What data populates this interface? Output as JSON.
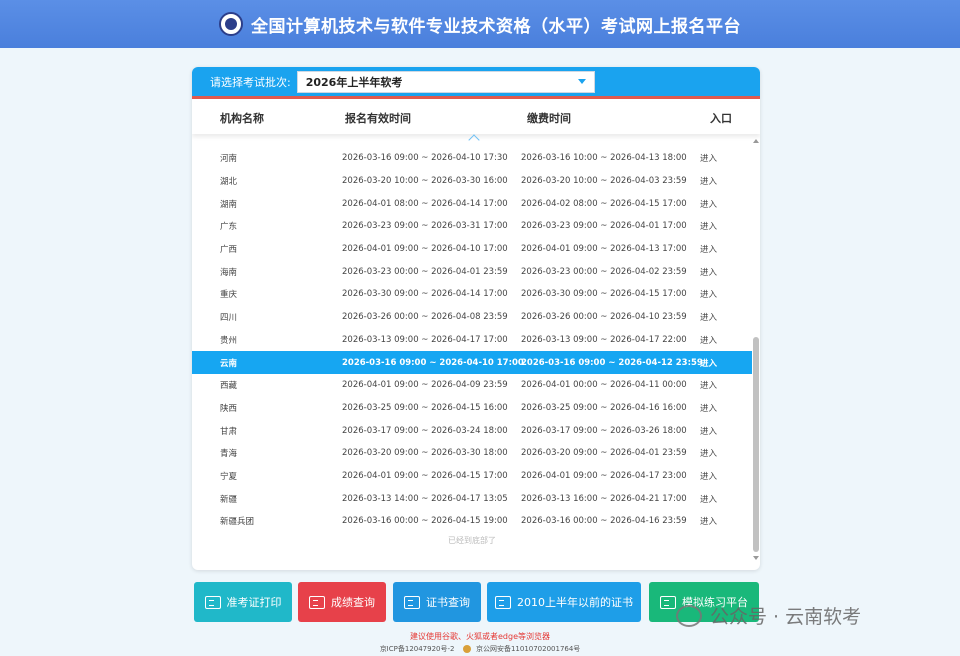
{
  "header": {
    "title": "全国计算机技术与软件专业技术资格（水平）考试网上报名平台"
  },
  "batch": {
    "label": "请选择考试批次:",
    "selected": "2026年上半年软考"
  },
  "table": {
    "columns": [
      "机构名称",
      "报名有效时间",
      "缴费时间",
      "入口"
    ],
    "rows": [
      {
        "name": "河南",
        "reg": "2026-03-16 09:00 ~ 2026-04-10 17:30",
        "pay": "2026-03-16 10:00 ~ 2026-04-13 18:00",
        "entry": "进入"
      },
      {
        "name": "湖北",
        "reg": "2026-03-20 10:00 ~ 2026-03-30 16:00",
        "pay": "2026-03-20 10:00 ~ 2026-04-03 23:59",
        "entry": "进入"
      },
      {
        "name": "湖南",
        "reg": "2026-04-01 08:00 ~ 2026-04-14 17:00",
        "pay": "2026-04-02 08:00 ~ 2026-04-15 17:00",
        "entry": "进入"
      },
      {
        "name": "广东",
        "reg": "2026-03-23 09:00 ~ 2026-03-31 17:00",
        "pay": "2026-03-23 09:00 ~ 2026-04-01 17:00",
        "entry": "进入"
      },
      {
        "name": "广西",
        "reg": "2026-04-01 09:00 ~ 2026-04-10 17:00",
        "pay": "2026-04-01 09:00 ~ 2026-04-13 17:00",
        "entry": "进入"
      },
      {
        "name": "海南",
        "reg": "2026-03-23 00:00 ~ 2026-04-01 23:59",
        "pay": "2026-03-23 00:00 ~ 2026-04-02 23:59",
        "entry": "进入"
      },
      {
        "name": "重庆",
        "reg": "2026-03-30 09:00 ~ 2026-04-14 17:00",
        "pay": "2026-03-30 09:00 ~ 2026-04-15 17:00",
        "entry": "进入"
      },
      {
        "name": "四川",
        "reg": "2026-03-26 00:00 ~ 2026-04-08 23:59",
        "pay": "2026-03-26 00:00 ~ 2026-04-10 23:59",
        "entry": "进入"
      },
      {
        "name": "贵州",
        "reg": "2026-03-13 09:00 ~ 2026-04-17 17:00",
        "pay": "2026-03-13 09:00 ~ 2026-04-17 22:00",
        "entry": "进入"
      },
      {
        "name": "云南",
        "reg": "2026-03-16 09:00 ~ 2026-04-10 17:00",
        "pay": "2026-03-16 09:00 ~ 2026-04-12 23:59",
        "entry": "进入",
        "highlight": true
      },
      {
        "name": "西藏",
        "reg": "2026-04-01 09:00 ~ 2026-04-09 23:59",
        "pay": "2026-04-01 00:00 ~ 2026-04-11 00:00",
        "entry": "进入"
      },
      {
        "name": "陕西",
        "reg": "2026-03-25 09:00 ~ 2026-04-15 16:00",
        "pay": "2026-03-25 09:00 ~ 2026-04-16 16:00",
        "entry": "进入"
      },
      {
        "name": "甘肃",
        "reg": "2026-03-17 09:00 ~ 2026-03-24 18:00",
        "pay": "2026-03-17 09:00 ~ 2026-03-26 18:00",
        "entry": "进入"
      },
      {
        "name": "青海",
        "reg": "2026-03-20 09:00 ~ 2026-03-30 18:00",
        "pay": "2026-03-20 09:00 ~ 2026-04-01 23:59",
        "entry": "进入"
      },
      {
        "name": "宁夏",
        "reg": "2026-04-01 09:00 ~ 2026-04-15 17:00",
        "pay": "2026-04-01 09:00 ~ 2026-04-17 23:00",
        "entry": "进入"
      },
      {
        "name": "新疆",
        "reg": "2026-03-13 14:00 ~ 2026-04-17 13:05",
        "pay": "2026-03-13 16:00 ~ 2026-04-21 17:00",
        "entry": "进入"
      },
      {
        "name": "新疆兵团",
        "reg": "2026-03-16 00:00 ~ 2026-04-15 19:00",
        "pay": "2026-03-16 00:00 ~ 2026-04-16 23:59",
        "entry": "进入"
      }
    ],
    "end_note": "已经到底部了"
  },
  "buttons": [
    {
      "label": "准考证打印",
      "icon": "id-card-icon"
    },
    {
      "label": "成绩查询",
      "icon": "score-report-icon"
    },
    {
      "label": "证书查询",
      "icon": "certificate-icon"
    },
    {
      "label": "2010上半年以前的证书",
      "icon": "certificate-icon"
    },
    {
      "label": "模拟练习平台",
      "icon": "practice-icon"
    }
  ],
  "watermark": {
    "text": "公众号 · 云南软考"
  },
  "footer": {
    "warning": "建议使用谷歌、火狐或者edge等浏览器",
    "icp": "京ICP备12047920号-2",
    "police": "京公网安备11010702001764号"
  },
  "colors": {
    "header": "#4a7fdc",
    "accent": "#1aa3ef",
    "highlight": "#16a6f2"
  }
}
